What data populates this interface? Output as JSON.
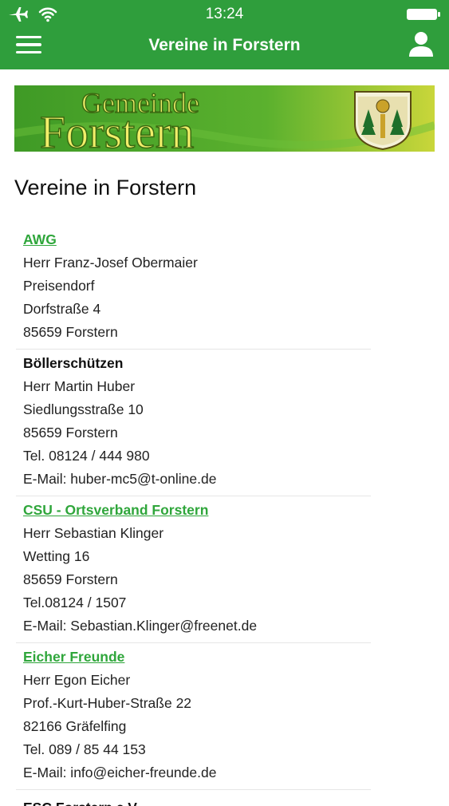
{
  "status": {
    "time": "13:24"
  },
  "nav": {
    "title": "Vereine in Forstern"
  },
  "banner": {
    "line1": "Gemeinde",
    "line2": "Forstern"
  },
  "page": {
    "title": "Vereine in Forstern"
  },
  "entries": [
    {
      "name": "AWG",
      "link": true,
      "lines": [
        "Herr Franz-Josef Obermaier",
        "Preisendorf",
        "Dorfstraße 4",
        "85659 Forstern"
      ]
    },
    {
      "name": "Böllerschützen",
      "link": false,
      "lines": [
        "Herr Martin Huber",
        "Siedlungsstraße 10",
        "85659 Forstern",
        "Tel. 08124 / 444 980",
        "E-Mail: huber-mc5@t-online.de"
      ]
    },
    {
      "name": "CSU - Ortsverband Forstern",
      "link": true,
      "lines": [
        "Herr Sebastian Klinger",
        "Wetting 16",
        "85659 Forstern",
        "Tel.08124 / 1507",
        "E-Mail: Sebastian.Klinger@freenet.de"
      ]
    },
    {
      "name": "Eicher Freunde",
      "link": true,
      "lines": [
        "Herr Egon Eicher",
        "Prof.-Kurt-Huber-Straße 22",
        "82166 Gräfelfing",
        "Tel. 089 / 85 44 153",
        "E-Mail: info@eicher-freunde.de"
      ]
    },
    {
      "name": "ESC Forstern e.V.",
      "link": false,
      "lines": []
    }
  ],
  "colors": {
    "header": "#2f9e3c",
    "link": "#2fa63b",
    "banner_bg": "#4aa52a",
    "banner_text": "#f2ee6a"
  }
}
